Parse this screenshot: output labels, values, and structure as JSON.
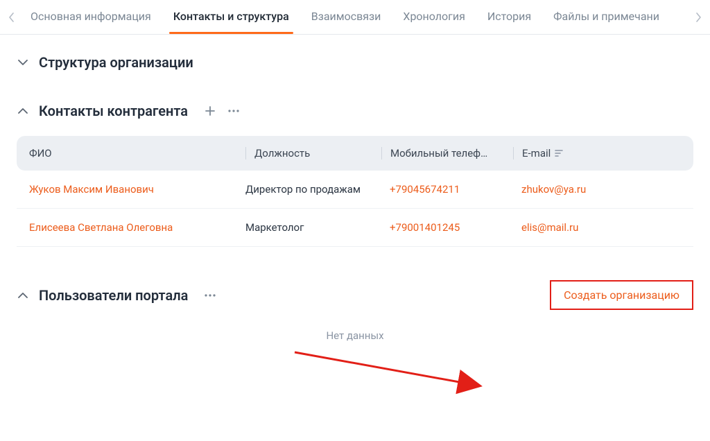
{
  "tabs": {
    "items": [
      "Основная информация",
      "Контакты и структура",
      "Взаимосвязи",
      "Хронология",
      "История",
      "Файлы и примечани"
    ],
    "active_index": 1
  },
  "sections": {
    "org_structure": {
      "title": "Структура организации",
      "expanded": false
    },
    "contacts": {
      "title": "Контакты контрагента",
      "expanded": true,
      "columns": {
        "fio": "ФИО",
        "position": "Должность",
        "phone": "Мобильный телеф…",
        "email": "E-mail"
      },
      "rows": [
        {
          "fio": "Жуков Максим Иванович",
          "position": "Директор по продажам",
          "phone": "+79045674211",
          "email": "zhukov@ya.ru"
        },
        {
          "fio": "Елисеева Светлана Олеговна",
          "position": "Маркетолог",
          "phone": "+79001401245",
          "email": "elis@mail.ru"
        }
      ]
    },
    "portal_users": {
      "title": "Пользователи портала",
      "expanded": true,
      "create_label": "Создать организацию",
      "empty_text": "Нет данных"
    }
  }
}
